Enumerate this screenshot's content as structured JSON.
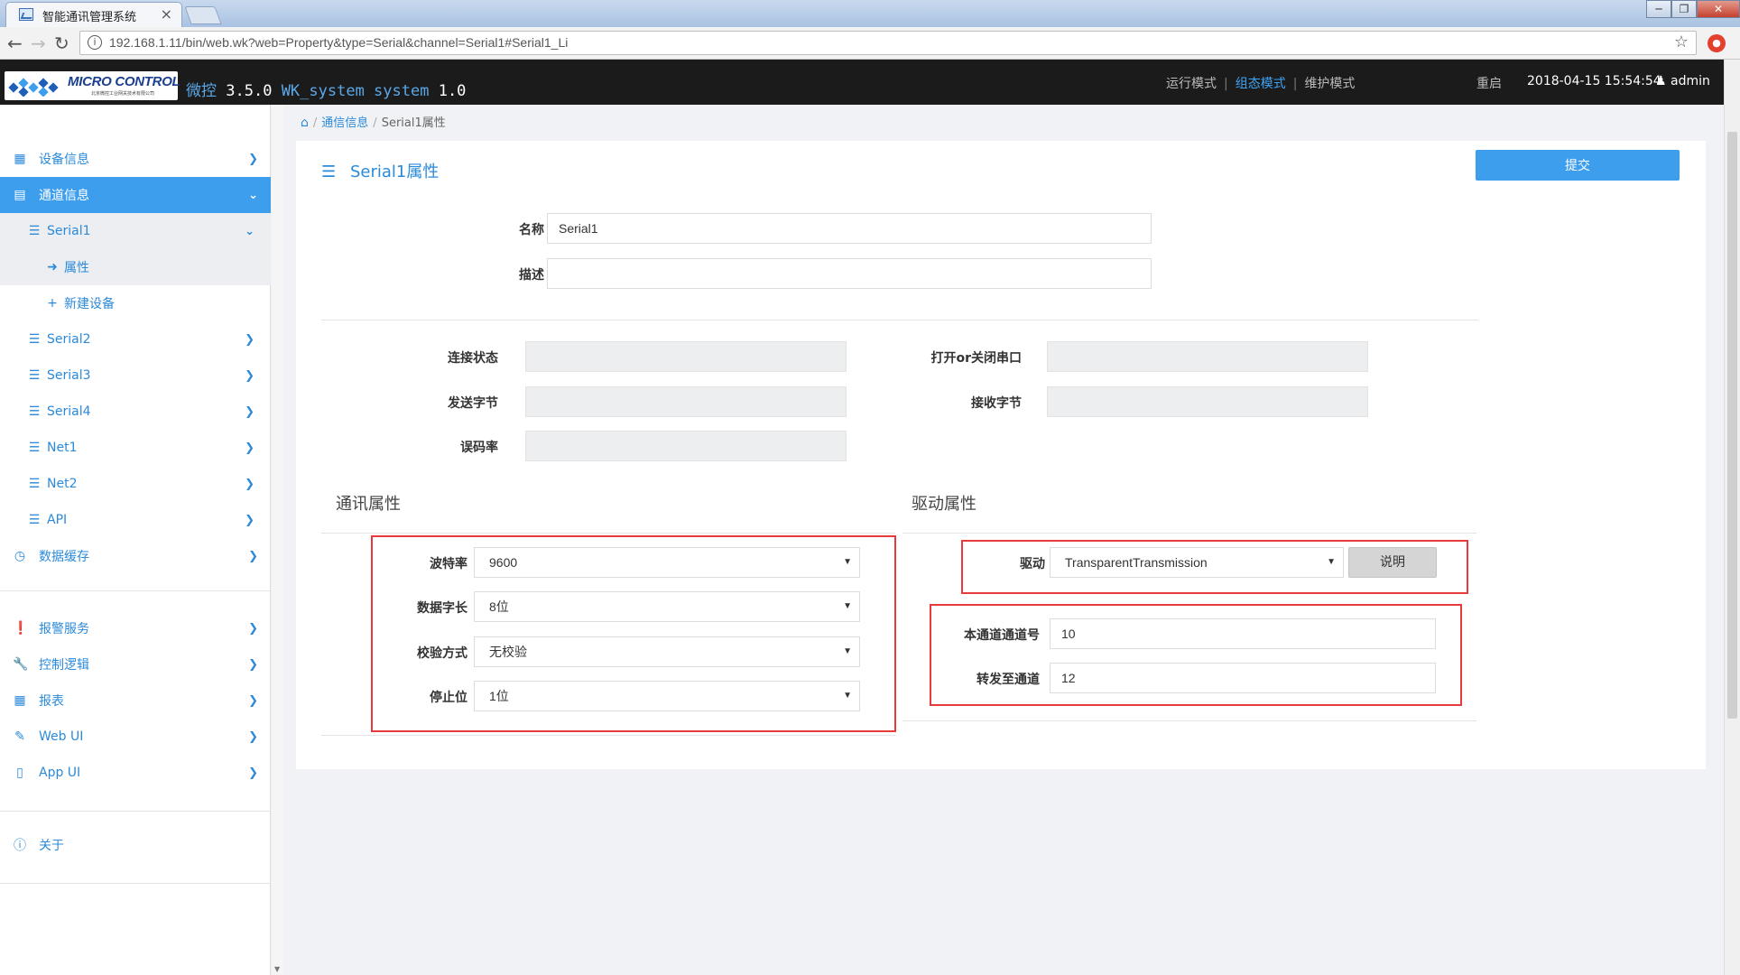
{
  "browser": {
    "tab_title": "智能通讯管理系统",
    "tab_close": "×",
    "url": "192.168.1.11/bin/web.wk?web=Property&type=Serial&channel=Serial1#Serial1_Li",
    "back": "←",
    "forward": "→",
    "reload": "↻",
    "info": "i",
    "star": "☆",
    "window_minimize": "─",
    "window_restore": "❐",
    "window_close": "✕"
  },
  "header": {
    "logo_text": "MICRO CONTROL",
    "logo_sub": "北京微控工业网关技术有限公司",
    "app_name": "微控",
    "version": "3.5.0",
    "system_label": "WK_system system",
    "system_version": "1.0",
    "modes": [
      "运行模式",
      "组态模式",
      "维护模式"
    ],
    "active_mode": "组态模式",
    "restart": "重启",
    "datetime": "2018-04-15 15:54:54",
    "user": "admin"
  },
  "sidebar": {
    "items": [
      {
        "label": "设备信息",
        "icon": "grid-icon"
      },
      {
        "label": "通道信息",
        "icon": "document-icon"
      },
      {
        "label": "Serial1",
        "icon": "list-icon"
      },
      {
        "label": "属性",
        "icon": "arrow-right-icon"
      },
      {
        "label": "新建设备",
        "icon": "plus-icon"
      },
      {
        "label": "Serial2",
        "icon": "list-icon"
      },
      {
        "label": "Serial3",
        "icon": "list-icon"
      },
      {
        "label": "Serial4",
        "icon": "list-icon"
      },
      {
        "label": "Net1",
        "icon": "list-icon"
      },
      {
        "label": "Net2",
        "icon": "list-icon"
      },
      {
        "label": "API",
        "icon": "list-icon"
      },
      {
        "label": "数据缓存",
        "icon": "clock-icon"
      },
      {
        "label": "报警服务",
        "icon": "alert-icon"
      },
      {
        "label": "控制逻辑",
        "icon": "wrench-icon"
      },
      {
        "label": "报表",
        "icon": "calendar-icon"
      },
      {
        "label": "Web UI",
        "icon": "pencil-icon"
      },
      {
        "label": "App UI",
        "icon": "mobile-icon"
      },
      {
        "label": "关于",
        "icon": "info-icon"
      }
    ]
  },
  "breadcrumb": {
    "items": [
      "通信信息",
      "Serial1属性"
    ]
  },
  "panel": {
    "title": "Serial1属性",
    "submit": "提交",
    "name_label": "名称",
    "name_value": "Serial1",
    "desc_label": "描述",
    "desc_value": "",
    "status": {
      "connection_label": "连接状态",
      "sent_label": "发送字节",
      "error_rate_label": "误码率",
      "open_close_label": "打开or关闭串口",
      "recv_label": "接收字节"
    },
    "comm": {
      "title": "通讯属性",
      "baud_label": "波特率",
      "baud_value": "9600",
      "databits_label": "数据字长",
      "databits_value": "8位",
      "parity_label": "校验方式",
      "parity_value": "无校验",
      "stopbits_label": "停止位",
      "stopbits_value": "1位"
    },
    "driver": {
      "title": "驱动属性",
      "driver_label": "驱动",
      "driver_value": "TransparentTransmission",
      "explain": "说明",
      "channel_no_label": "本通道通道号",
      "channel_no_value": "10",
      "forward_label": "转发至通道",
      "forward_value": "12"
    }
  },
  "colors": {
    "accent": "#3d9eee",
    "header_bg": "#1b1b1b",
    "highlight_box": "#e83a3a"
  }
}
